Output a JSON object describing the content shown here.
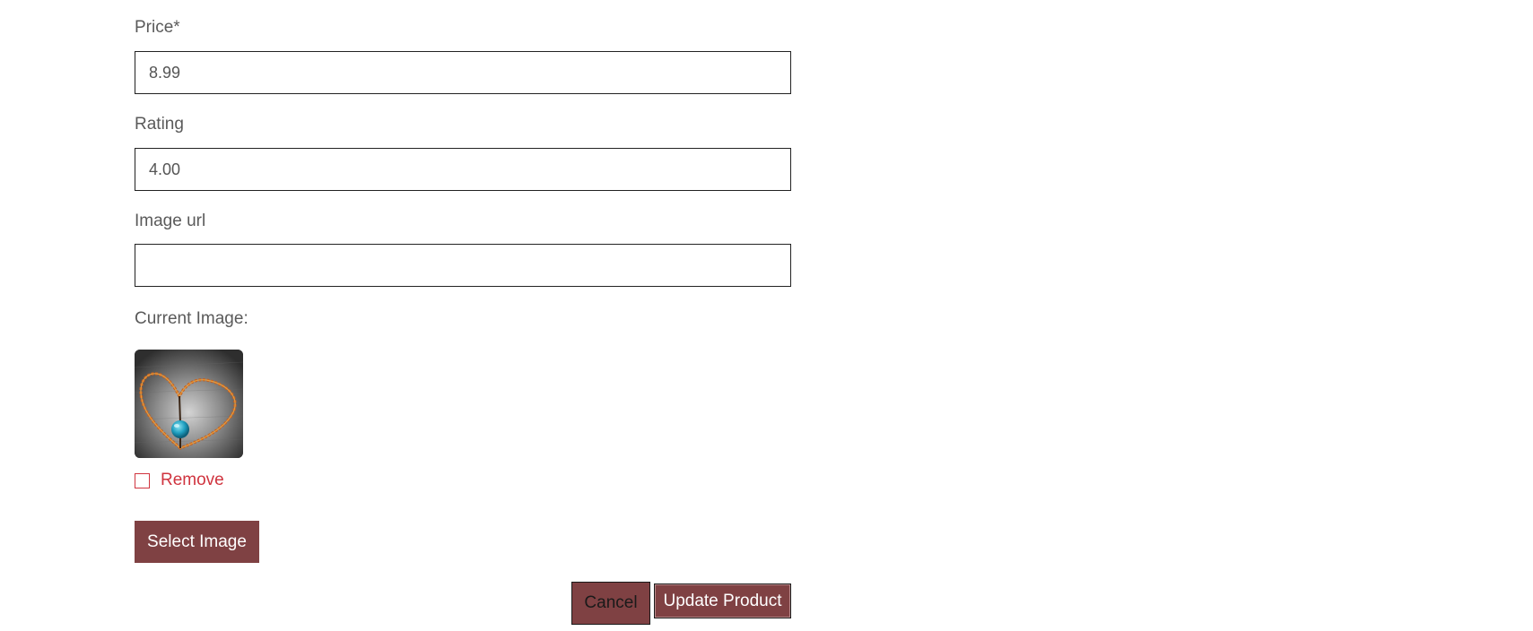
{
  "form": {
    "price": {
      "label": "Price*",
      "value": "8.99"
    },
    "rating": {
      "label": "Rating",
      "value": "4.00"
    },
    "image_url": {
      "label": "Image url",
      "value": ""
    },
    "current_image": {
      "label": "Current Image:",
      "description": "product-thumbnail-heart-necklace"
    },
    "remove": {
      "label": "Remove",
      "checked": false
    },
    "select_image_label": "Select Image",
    "cancel_label": "Cancel",
    "update_label": "Update Product"
  },
  "colors": {
    "button_bg": "#7f4143",
    "remove_red": "#d0343f",
    "label_gray": "#5a5a5a",
    "border": "#222222"
  }
}
